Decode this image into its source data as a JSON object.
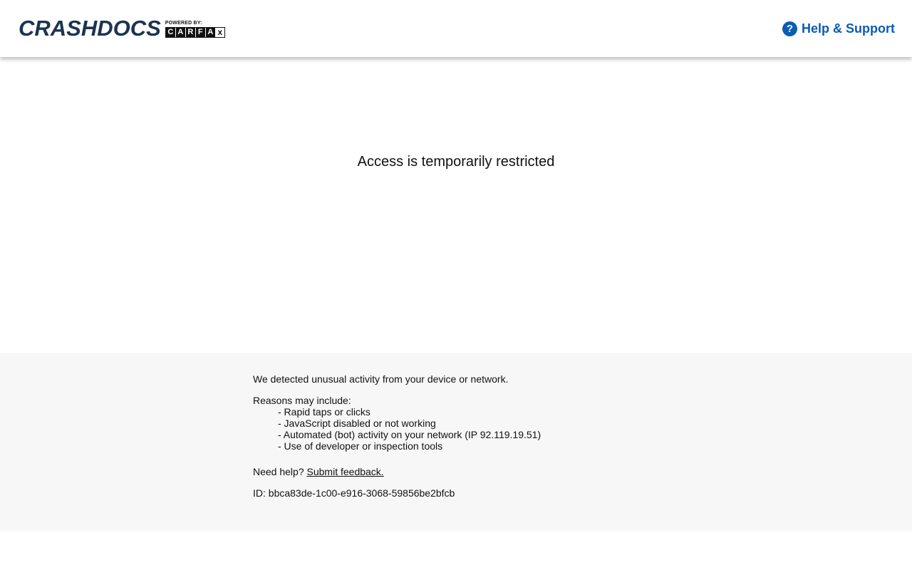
{
  "header": {
    "logo_text": "CRASHDOCS",
    "powered_by": "POWERED BY:",
    "carfax_letters": [
      "C",
      "A",
      "R",
      "F",
      "A",
      "x"
    ],
    "help_icon": "question-circle-icon",
    "help_label": "Help & Support",
    "brand_color": "#1b3450",
    "accent_color": "#0b5cb5"
  },
  "main": {
    "title": "Access is temporarily restricted"
  },
  "info": {
    "detected": "We detected unusual activity from your device or network.",
    "reasons_title": "Reasons may include:",
    "reasons": [
      "- Rapid taps or clicks",
      "- JavaScript disabled or not working",
      "- Automated (bot) activity on your network (IP 92.119.19.51)",
      "- Use of developer or inspection tools"
    ],
    "need_help": "Need help?",
    "feedback_link": "Submit feedback.",
    "id_label": "ID:",
    "id_value": "bbca83de-1c00-e916-3068-59856be2bfcb",
    "background_color": "#f7f7f7"
  }
}
